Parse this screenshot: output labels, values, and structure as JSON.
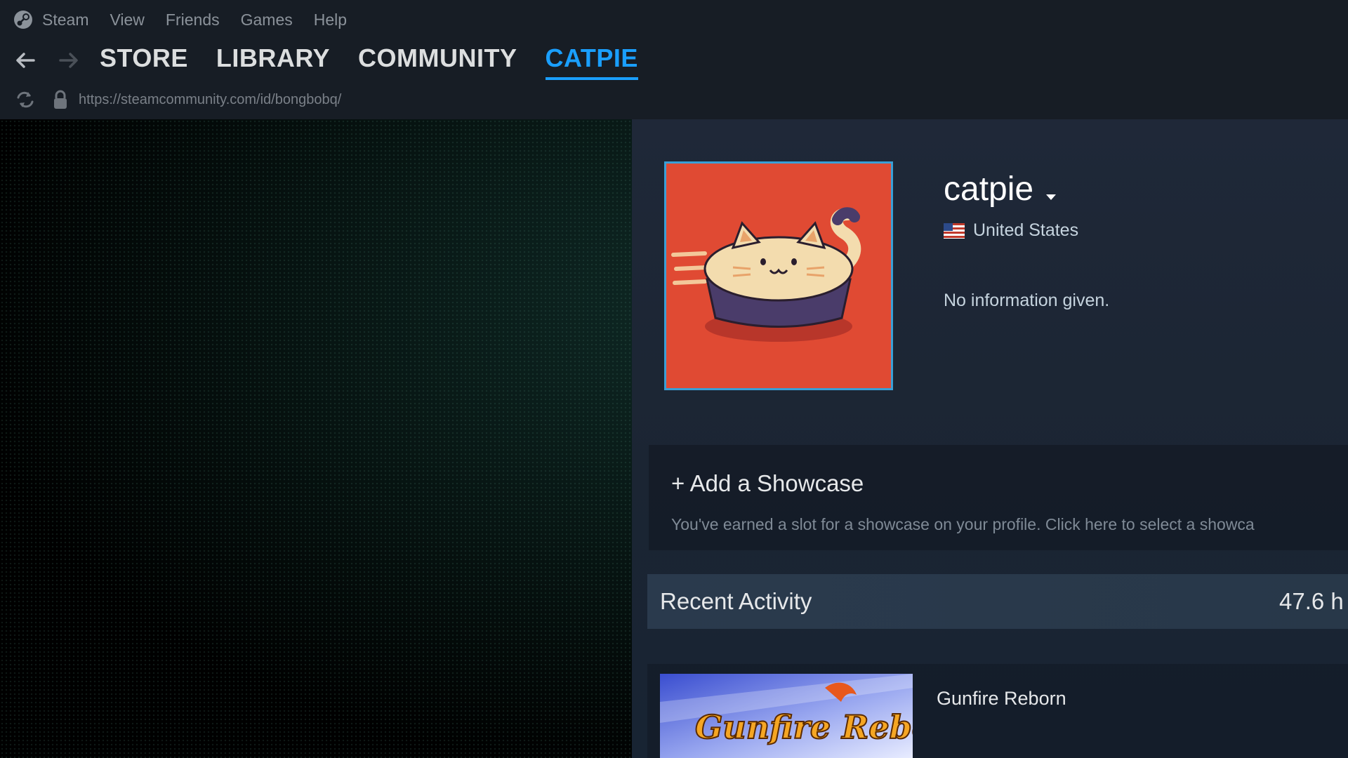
{
  "menubar": {
    "app_name": "Steam",
    "items": [
      "View",
      "Friends",
      "Games",
      "Help"
    ]
  },
  "navbar": {
    "tabs": [
      {
        "label": "STORE"
      },
      {
        "label": "LIBRARY"
      },
      {
        "label": "COMMUNITY"
      },
      {
        "label": "CATPIE",
        "active": true
      }
    ]
  },
  "urlbar": {
    "url": "https://steamcommunity.com/id/bongbobq/"
  },
  "profile": {
    "persona_name": "catpie",
    "location": "United States",
    "summary": "No information given.",
    "showcase": {
      "title": "+ Add a Showcase",
      "description": "You've earned a slot for a showcase on your profile. Click here to select a showca"
    },
    "recent_activity": {
      "title": "Recent Activity",
      "hours": "47.6 h"
    },
    "games": [
      {
        "name": "Gunfire Reborn",
        "capsule_text": "Gunfire Reborn"
      }
    ]
  },
  "colors": {
    "accent": "#1a9fff",
    "avatar_bg": "#e04a33",
    "chrome_bg": "#171d25"
  }
}
